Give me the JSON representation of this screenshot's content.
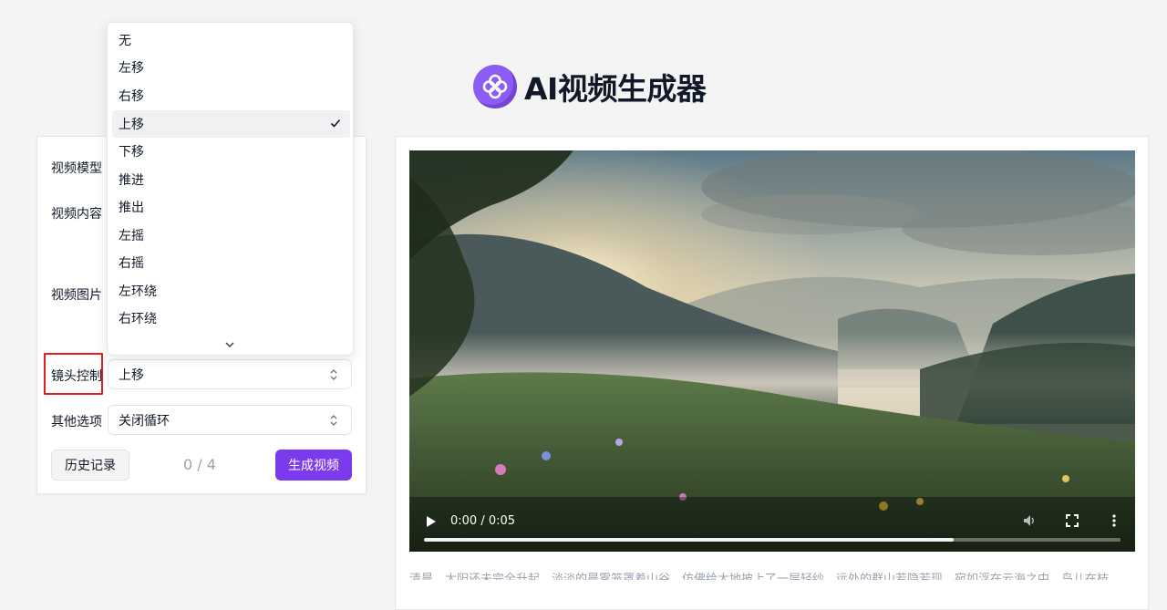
{
  "app": {
    "title": "AI视频生成器"
  },
  "form": {
    "model_label": "视频模型",
    "content_label": "视频内容",
    "image_label": "视频图片",
    "camera_label": "镜头控制",
    "camera_value": "上移",
    "other_label": "其他选项",
    "other_value": "关闭循环",
    "history_button": "历史记录",
    "counter": "0 / 4",
    "generate_button": "生成视频"
  },
  "dropdown": {
    "options": [
      "无",
      "左移",
      "右移",
      "上移",
      "下移",
      "推进",
      "推出",
      "左摇",
      "右摇",
      "左环绕",
      "右环绕"
    ],
    "selected": "上移"
  },
  "video": {
    "time": "0:00 / 0:05",
    "progress": 0.76
  },
  "description": "清晨，太阳还未完全升起，淡淡的晨雾笼罩着山谷，仿佛给大地披上了一层轻纱，远处的群山若隐若现，宛如浮在云海之中，鸟儿在枝",
  "colors": {
    "accent": "#7c3aed",
    "highlight": "#e11d20"
  }
}
